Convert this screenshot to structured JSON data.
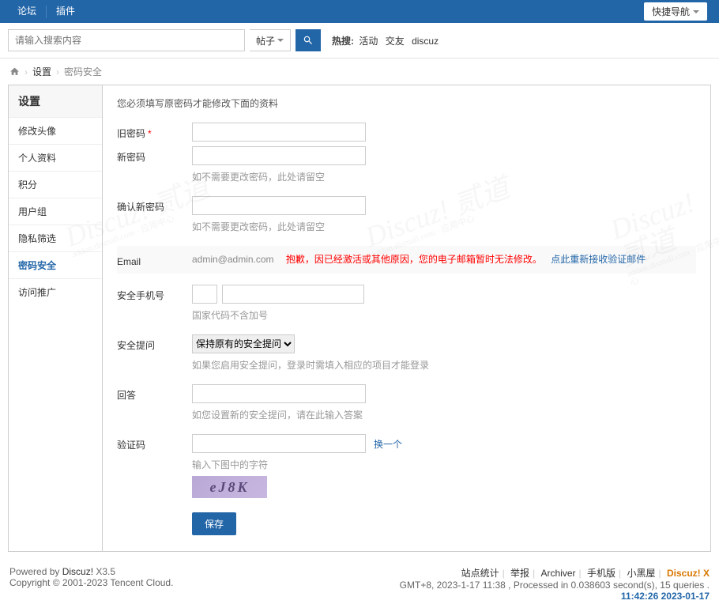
{
  "topnav": {
    "forum": "论坛",
    "plugin": "插件",
    "quicknav": "快捷导航"
  },
  "search": {
    "placeholder": "请输入搜索内容",
    "type": "帖子",
    "hot_label": "热搜:",
    "hot": [
      "活动",
      "交友",
      "discuz"
    ]
  },
  "breadcrumb": {
    "settings": "设置",
    "current": "密码安全"
  },
  "sidebar": {
    "title": "设置",
    "items": [
      "修改头像",
      "个人资料",
      "积分",
      "用户组",
      "隐私筛选",
      "密码安全",
      "访问推广"
    ],
    "active_index": 5
  },
  "form": {
    "notice": "您必须填写原密码才能修改下面的资料",
    "old_pwd": "旧密码",
    "new_pwd": "新密码",
    "new_pwd_hint": "如不需要更改密码，此处请留空",
    "confirm_pwd": "确认新密码",
    "confirm_pwd_hint": "如不需要更改密码，此处请留空",
    "email_label": "Email",
    "email_value": "admin@admin.com",
    "email_warn": "抱歉，因已经激活或其他原因，您的电子邮箱暂时无法修改。",
    "email_resend": "点此重新接收验证邮件",
    "phone_label": "安全手机号",
    "phone_hint": "国家代码不含加号",
    "secq_label": "安全提问",
    "secq_value": "保持原有的安全提问和答案",
    "secq_hint": "如果您启用安全提问，登录时需填入相应的项目才能登录",
    "answer_label": "回答",
    "answer_hint": "如您设置新的安全提问，请在此输入答案",
    "captcha_label": "验证码",
    "captcha_change": "换一个",
    "captcha_hint": "输入下图中的字符",
    "captcha_text": "eJ8K",
    "save": "保存"
  },
  "footer": {
    "powered": "Powered by ",
    "brand": "Discuz!",
    "version": " X3.5",
    "copyright": "Copyright © 2001-2023 Tencent Cloud.",
    "links": [
      "站点统计",
      "举报",
      "Archiver",
      "手机版",
      "小黑屋"
    ],
    "dzx": "Discuz! X",
    "gmt": "GMT+8, 2023-1-17 11:38 , Processed in 0.038603 second(s), 15 queries .",
    "time": "11:42:26 2023-01-17"
  }
}
